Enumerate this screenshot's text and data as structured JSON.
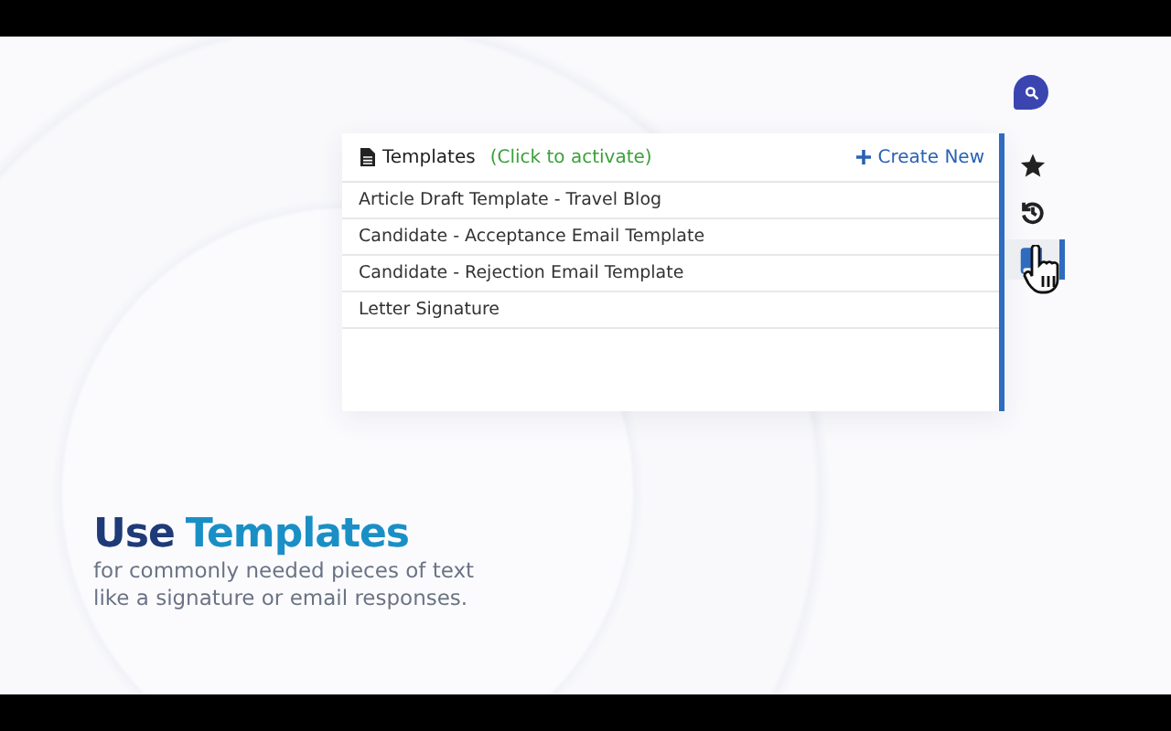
{
  "panel": {
    "title": "Templates",
    "hint": "(Click to activate)",
    "create_label": "Create New",
    "items": [
      "Article Draft Template - Travel Blog",
      "Candidate - Acceptance Email Template",
      "Candidate - Rejection Email Template",
      "Letter Signature"
    ]
  },
  "sidebar_items": [
    {
      "kind": "star",
      "selected": false
    },
    {
      "kind": "history",
      "selected": false
    },
    {
      "kind": "book",
      "selected": true
    }
  ],
  "headline": {
    "first": "Use",
    "second": "Templates"
  },
  "subtitle": "for commonly needed pieces of text like a signature or email responses."
}
